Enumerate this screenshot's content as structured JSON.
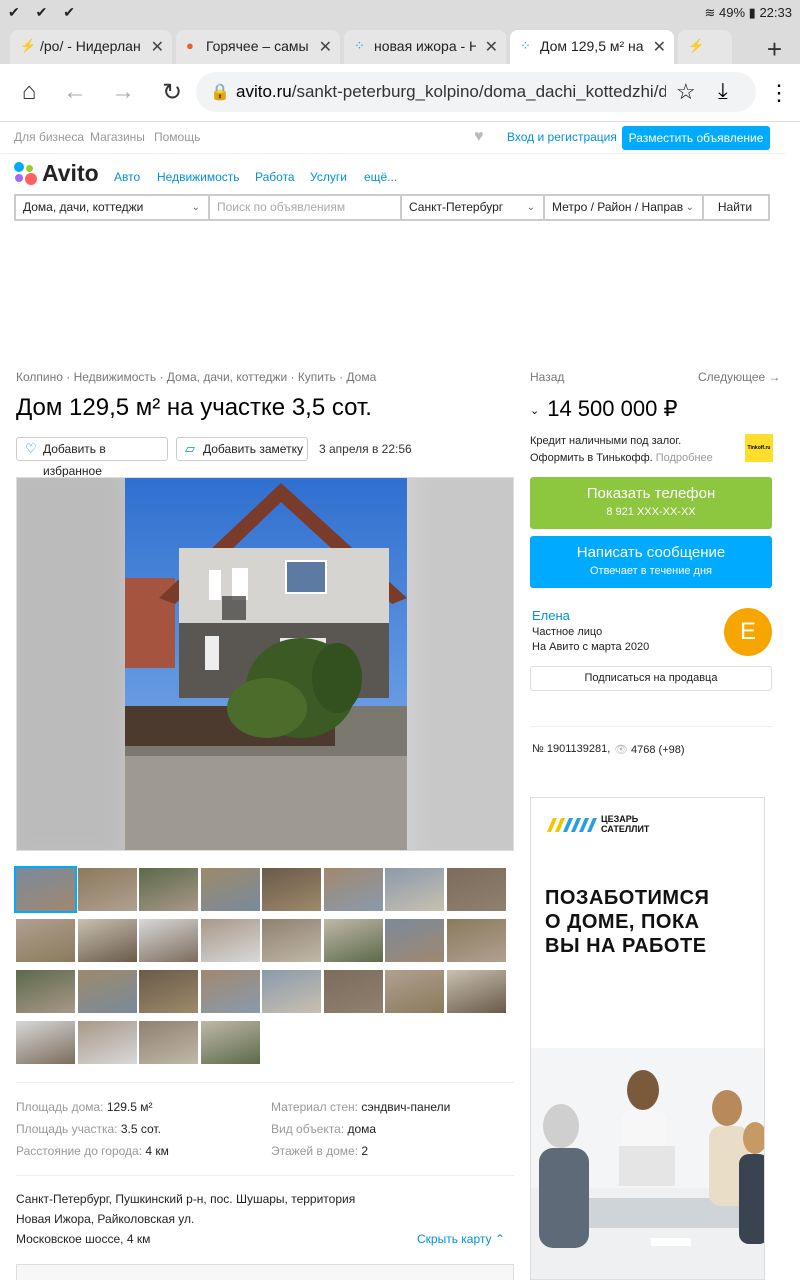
{
  "status": {
    "left": "✔ ✔ ✔",
    "battery": "49%",
    "time": "22:33"
  },
  "tabs": [
    {
      "title": "/ро/ - Нидерлан",
      "icon": "lightning-icon"
    },
    {
      "title": "Горячее – самы",
      "icon": "pikabu-icon"
    },
    {
      "title": "новая ижора - H",
      "icon": "avito-icon"
    },
    {
      "title": "Дом 129,5 м² на",
      "icon": "avito-icon"
    },
    {
      "title": "",
      "icon": "lightning-icon"
    }
  ],
  "address": {
    "host": "avito.ru",
    "path": "/sankt-peterburg_kolpino/doma_dachi_kottedzhi/dom"
  },
  "topbar": {
    "business": "Для бизнеса",
    "shops": "Магазины",
    "help": "Помощь",
    "login": "Вход и регистрация",
    "post": "Разместить объявление"
  },
  "logo": "Avito",
  "nav": [
    "Авто",
    "Недвижимость",
    "Работа",
    "Услуги",
    "ещё..."
  ],
  "search": {
    "category": "Дома, дачи, коттеджи",
    "placeholder": "Поиск по объявлениям",
    "city": "Санкт-Петербург",
    "metro": "Метро / Район / Направ",
    "find": "Найти"
  },
  "listing": {
    "breadcrumbs": "Колпино · Недвижимость · Дома, дачи, коттеджи · Купить · Дома",
    "back": "Назад",
    "next": "Следующее →",
    "title": "Дом 129,5 м² на участке 3,5 сот.",
    "price": "14 500 000 ₽",
    "fav": "Добавить в избранное",
    "note": "Добавить заметку",
    "posted": "3 апреля в 22:56",
    "credit_line1": "Кредит наличными под залог.",
    "credit_line2": "Оформить в Тинькофф.",
    "credit_more": "Подробнее",
    "tinkoff": "Tinkoff.ru"
  },
  "contact": {
    "phone_label": "Показать телефон",
    "phone": "8 921 XXX-XX-XX",
    "msg_label": "Написать сообщение",
    "msg_sub": "Отвечает в течение дня",
    "colors": {
      "phone": "#8dc63f",
      "msg": "#00aaff"
    }
  },
  "seller": {
    "name": "Елена",
    "type": "Частное лицо",
    "since": "На Авито с марта 2020",
    "initial": "Е",
    "subscribe": "Подписаться на продавца"
  },
  "meta": {
    "id": "№ 1901139281,",
    "views": "4768 (+98)"
  },
  "params": [
    {
      "label": "Площадь дома:",
      "value": "129.5 м²"
    },
    {
      "label": "Площадь участка:",
      "value": "3.5 сот."
    },
    {
      "label": "Расстояние до города:",
      "value": "4 км"
    },
    {
      "label": "Материал стен:",
      "value": "сэндвич-панели"
    },
    {
      "label": "Вид объекта:",
      "value": "дома"
    },
    {
      "label": "Этажей в доме:",
      "value": "2"
    }
  ],
  "location": {
    "line1": "Санкт-Петербург, Пушкинский р-н, пос. Шушары, территория",
    "line2": "Новая Ижора, Райколовская ул.",
    "line3": "Московское шоссе, 4 км",
    "hide_map": "Скрыть карту ⌃"
  },
  "ad": {
    "brand": "ЦЕЗАРЬ САТЕЛЛИТ",
    "headline1": "ПОЗАБОТИМСЯ",
    "headline2": "О ДОМЕ, ПОКА",
    "headline3": "ВЫ НА РАБОТЕ"
  },
  "thumb_count": 28
}
